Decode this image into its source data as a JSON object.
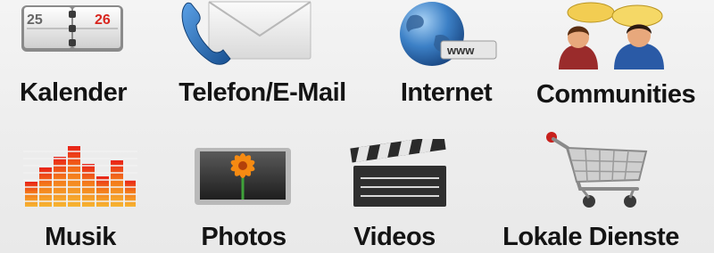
{
  "apps": [
    {
      "id": "kalender",
      "label": "Kalender",
      "icon": "calendar-icon",
      "calendar_days": [
        "25",
        "26"
      ]
    },
    {
      "id": "telefon-email",
      "label": "Telefon/E-Mail",
      "icon": "phone-envelope-icon"
    },
    {
      "id": "internet",
      "label": "Internet",
      "icon": "globe-icon",
      "badge_text": "www"
    },
    {
      "id": "communities",
      "label": "Communities",
      "icon": "community-chat-icon"
    },
    {
      "id": "musik",
      "label": "Musik",
      "icon": "equalizer-icon"
    },
    {
      "id": "photos",
      "label": "Photos",
      "icon": "photo-flower-icon"
    },
    {
      "id": "videos",
      "label": "Videos",
      "icon": "clapperboard-icon"
    },
    {
      "id": "lokale-dienste",
      "label": "Lokale Dienste",
      "icon": "shopping-cart-icon"
    }
  ],
  "colors": {
    "label_text": "#141414",
    "background": "#ededed",
    "calendar_red": "#d8261f",
    "phone_blue": "#1f5fa8",
    "globe_blue": "#2d6fb5",
    "music_orange": "#f07a1a",
    "flower_orange": "#f58a12",
    "cart_red": "#c8201c"
  }
}
